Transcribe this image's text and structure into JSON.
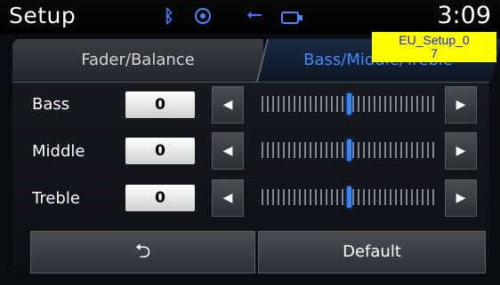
{
  "header": {
    "title": "Setup",
    "time": "3:09",
    "icons": [
      "bluetooth-icon",
      "media-source-icon",
      "usb-icon",
      "ipod-icon"
    ],
    "icon_glyphs": {
      "bluetooth": "ᛒ",
      "usb": "⭠"
    }
  },
  "overlay_label": "EU_Setup_0\n7",
  "tabs": [
    {
      "label": "Fader/Balance",
      "active": false
    },
    {
      "label": "Bass/Middle/Treble",
      "active": true
    }
  ],
  "rows": [
    {
      "label": "Bass",
      "value": "0",
      "level": 0.5
    },
    {
      "label": "Middle",
      "value": "0",
      "level": 0.5
    },
    {
      "label": "Treble",
      "value": "0",
      "level": 0.5
    }
  ],
  "arrows": {
    "left": "◀",
    "right": "▶"
  },
  "buttons": {
    "back_glyph": "⮌",
    "default_label": "Default"
  },
  "colors": {
    "accent": "#3f8bff",
    "highlight": "#ffff00"
  }
}
